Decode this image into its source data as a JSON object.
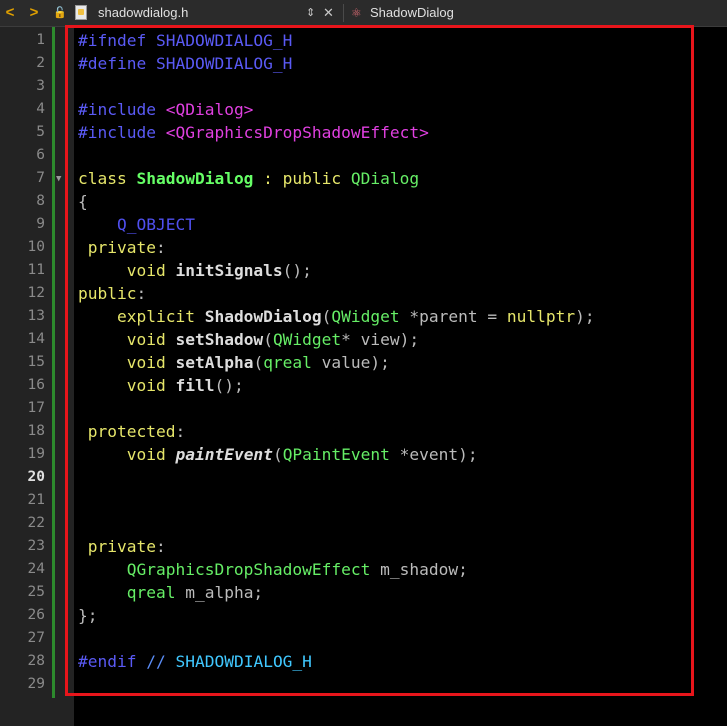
{
  "toolbar": {
    "back_icon": "chevron-left-icon",
    "back_glyph": "<",
    "forward_icon": "chevron-right-icon",
    "forward_glyph": ">",
    "file_name": "shadowdialog.h",
    "symbol_name": "ShadowDialog"
  },
  "editor": {
    "active_line": 20,
    "lines": [
      {
        "n": "1",
        "tokens": [
          [
            "kw-pre",
            "#ifndef SHADOWDIALOG_H"
          ]
        ]
      },
      {
        "n": "2",
        "tokens": [
          [
            "kw-pre",
            "#define SHADOWDIALOG_H"
          ]
        ]
      },
      {
        "n": "3",
        "tokens": []
      },
      {
        "n": "4",
        "tokens": [
          [
            "kw-pre",
            "#include "
          ],
          [
            "kw-inc",
            "<QDialog>"
          ]
        ]
      },
      {
        "n": "5",
        "tokens": [
          [
            "kw-pre",
            "#include "
          ],
          [
            "kw-inc",
            "<QGraphicsDropShadowEffect>"
          ]
        ]
      },
      {
        "n": "6",
        "tokens": []
      },
      {
        "n": "7",
        "tokens": [
          [
            "kw-class",
            "class "
          ],
          [
            "class-name",
            "ShadowDialog"
          ],
          [
            "kw-type",
            " : public "
          ],
          [
            "type-qt",
            "QDialog"
          ]
        ]
      },
      {
        "n": "8",
        "tokens": [
          [
            "punct",
            "{"
          ]
        ]
      },
      {
        "n": "9",
        "tokens": [
          [
            "plain",
            "    "
          ],
          [
            "macro",
            "Q_OBJECT"
          ]
        ]
      },
      {
        "n": "10",
        "tokens": [
          [
            "kw-type",
            " private"
          ],
          [
            "punct",
            ":"
          ]
        ]
      },
      {
        "n": "11",
        "tokens": [
          [
            "plain",
            "     "
          ],
          [
            "kw-type",
            "void "
          ],
          [
            "fn",
            "initSignals"
          ],
          [
            "punct",
            "();"
          ]
        ]
      },
      {
        "n": "12",
        "tokens": [
          [
            "kw-type",
            "public"
          ],
          [
            "punct",
            ":"
          ]
        ]
      },
      {
        "n": "13",
        "tokens": [
          [
            "plain",
            "    "
          ],
          [
            "kw-type",
            "explicit "
          ],
          [
            "fn",
            "ShadowDialog"
          ],
          [
            "punct",
            "("
          ],
          [
            "type-qt",
            "QWidget"
          ],
          [
            "plain",
            " *parent = "
          ],
          [
            "kw-type",
            "nullptr"
          ],
          [
            "punct",
            ");"
          ]
        ]
      },
      {
        "n": "14",
        "tokens": [
          [
            "plain",
            "     "
          ],
          [
            "kw-type",
            "void "
          ],
          [
            "fn",
            "setShadow"
          ],
          [
            "punct",
            "("
          ],
          [
            "type-qt",
            "QWidget"
          ],
          [
            "plain",
            "* view);"
          ]
        ]
      },
      {
        "n": "15",
        "tokens": [
          [
            "plain",
            "     "
          ],
          [
            "kw-type",
            "void "
          ],
          [
            "fn",
            "setAlpha"
          ],
          [
            "punct",
            "("
          ],
          [
            "type-qt",
            "qreal"
          ],
          [
            "plain",
            " value);"
          ]
        ]
      },
      {
        "n": "16",
        "tokens": [
          [
            "plain",
            "     "
          ],
          [
            "kw-type",
            "void "
          ],
          [
            "fn",
            "fill"
          ],
          [
            "punct",
            "();"
          ]
        ]
      },
      {
        "n": "17",
        "tokens": []
      },
      {
        "n": "18",
        "tokens": [
          [
            "kw-type",
            " protected"
          ],
          [
            "punct",
            ":"
          ]
        ]
      },
      {
        "n": "19",
        "tokens": [
          [
            "plain",
            "     "
          ],
          [
            "kw-type",
            "void "
          ],
          [
            "fn-it",
            "paintEvent"
          ],
          [
            "punct",
            "("
          ],
          [
            "type-qt",
            "QPaintEvent"
          ],
          [
            "plain",
            " *event);"
          ]
        ]
      },
      {
        "n": "20",
        "tokens": []
      },
      {
        "n": "21",
        "tokens": []
      },
      {
        "n": "22",
        "tokens": []
      },
      {
        "n": "23",
        "tokens": [
          [
            "kw-type",
            " private"
          ],
          [
            "punct",
            ":"
          ]
        ]
      },
      {
        "n": "24",
        "tokens": [
          [
            "plain",
            "     "
          ],
          [
            "type-qt",
            "QGraphicsDropShadowEffect"
          ],
          [
            "plain",
            " m_shadow;"
          ]
        ]
      },
      {
        "n": "25",
        "tokens": [
          [
            "plain",
            "     "
          ],
          [
            "type-qt",
            "qreal"
          ],
          [
            "plain",
            " m_alpha;"
          ]
        ]
      },
      {
        "n": "26",
        "tokens": [
          [
            "punct",
            "};"
          ]
        ]
      },
      {
        "n": "27",
        "tokens": []
      },
      {
        "n": "28",
        "tokens": [
          [
            "kw-pre",
            "#endif "
          ],
          [
            "comment",
            "// "
          ],
          [
            "comment-id",
            "SHADOWDIALOG_H"
          ]
        ]
      },
      {
        "n": "29",
        "tokens": []
      }
    ]
  },
  "colors": {
    "highlight_border": "#e8151b",
    "gutter_modified": "#2d8a2d",
    "background": "#000000"
  }
}
